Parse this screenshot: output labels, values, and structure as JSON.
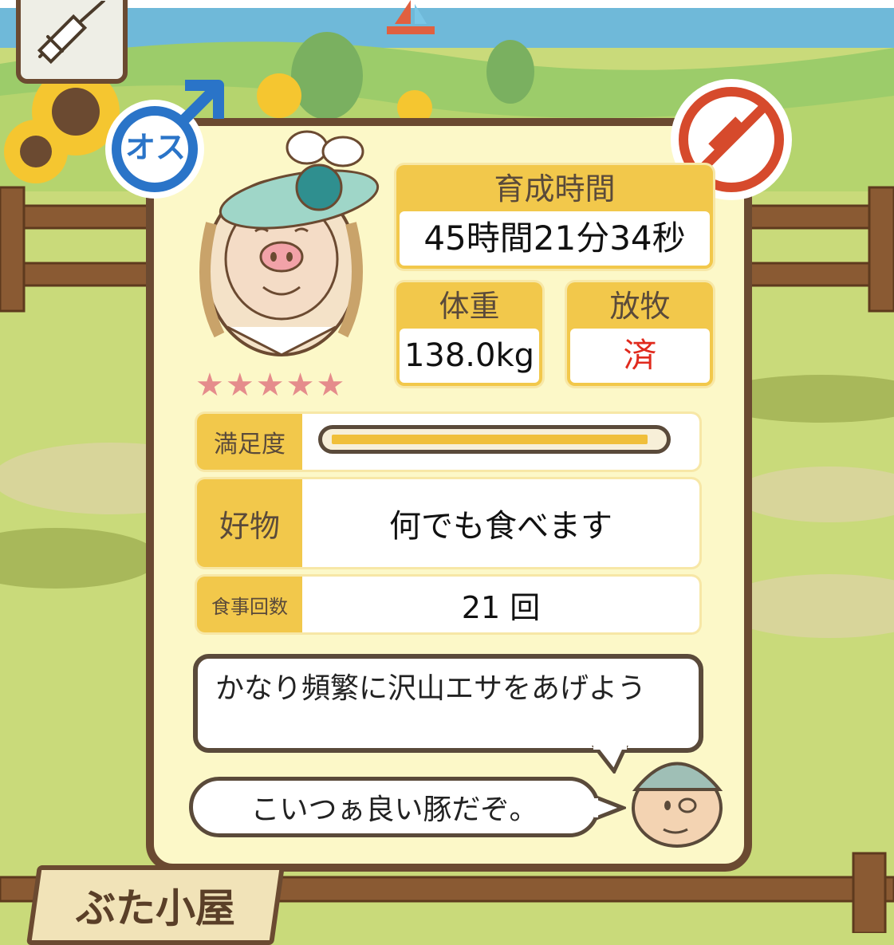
{
  "scene": "pig-hut-detail",
  "colors": {
    "panel_bg": "#fcf8c8",
    "panel_border": "#6b4a31",
    "label_yellow": "#f2c84b",
    "gender_blue": "#2a74c8",
    "no_vaccine_red": "#d64a2c",
    "graze_status_red": "#e02a1d",
    "star_pink": "#e58c8c"
  },
  "icons": {
    "top_left_button": "syringe-icon",
    "gender_badge": "male-symbol-icon",
    "vaccine_status": "no-syringe-icon",
    "avatar": "pig-in-bonnet",
    "advisor": "farmer-face"
  },
  "gender": {
    "label": "オス"
  },
  "rating": {
    "stars": "★★★★★",
    "value": 5,
    "max": 5
  },
  "stats": {
    "time": {
      "label": "育成時間",
      "value": "45時間21分34秒"
    },
    "weight": {
      "label": "体重",
      "value": "138.0kg"
    },
    "graze": {
      "label": "放牧",
      "value": "済"
    }
  },
  "satisfaction": {
    "label": "満足度",
    "fraction": 0.97
  },
  "favorite": {
    "label": "好物",
    "value": "何でも食べます"
  },
  "meals": {
    "label": "食事回数",
    "value": "21 回"
  },
  "advice": {
    "tip": "かなり頻繁に沢山エサをあげよう",
    "comment": "こいつぁ良い豚だぞ。"
  },
  "sign": {
    "label": "ぶた小屋"
  }
}
